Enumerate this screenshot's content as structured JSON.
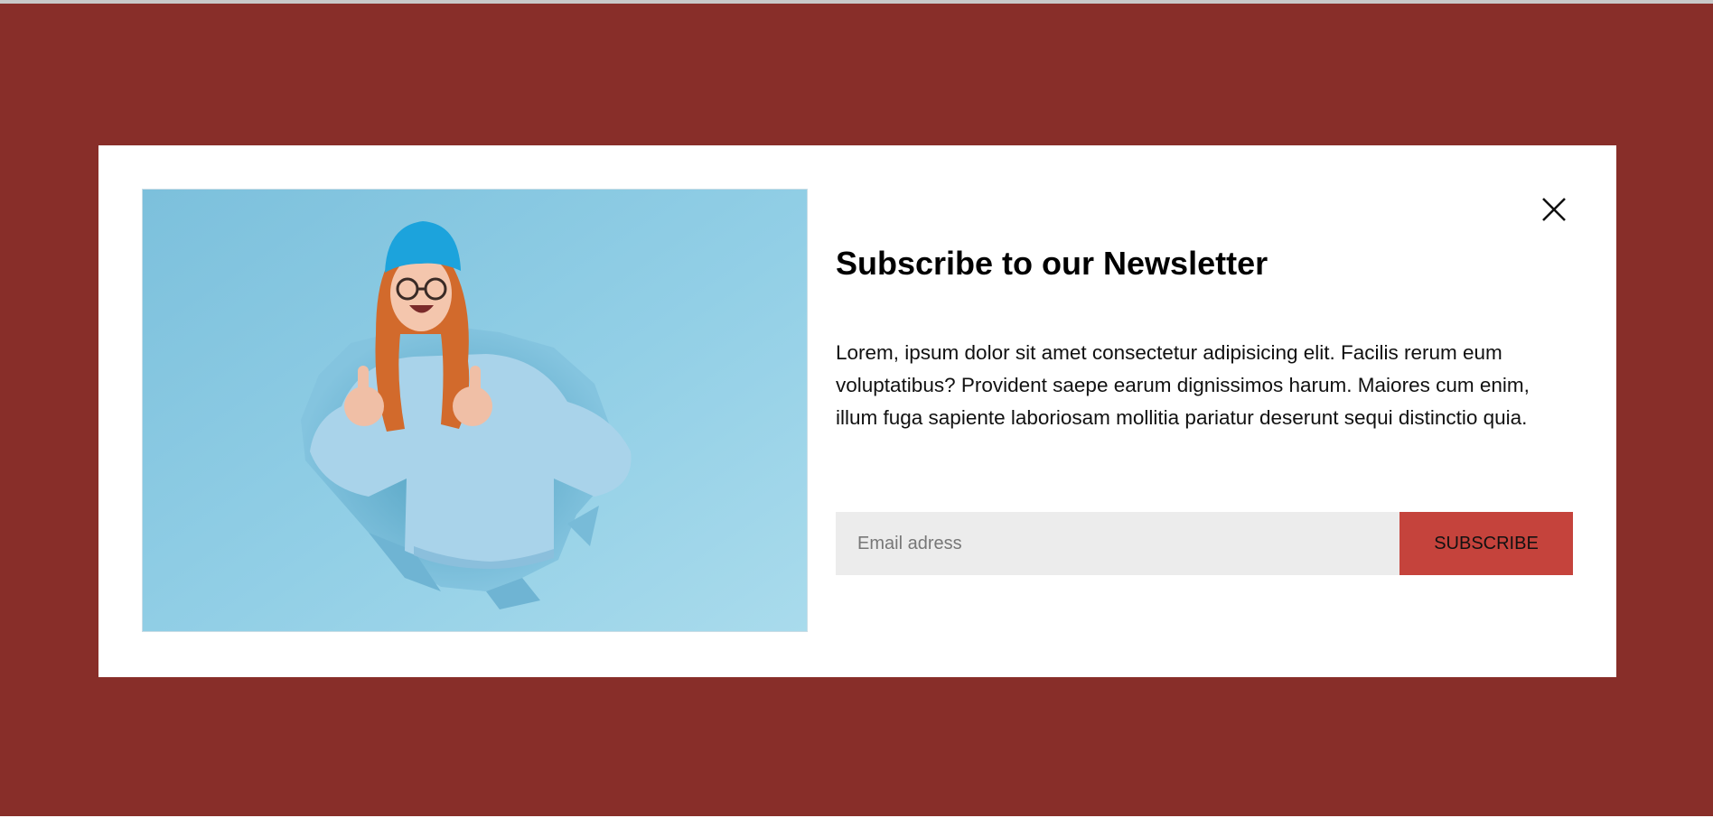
{
  "colors": {
    "backdrop": "#882e29",
    "modal_background": "#ffffff",
    "accent": "#c5433c",
    "input_background": "#ececec"
  },
  "newsletter": {
    "title": "Subscribe to our Newsletter",
    "description": "Lorem, ipsum dolor sit amet consectetur adipisicing elit. Facilis rerum eum voluptatibus? Provident saepe earum dignissimos harum. Maiores cum enim, illum fuga sapiente laboriosam mollitia pariatur deserunt sequi distinctio quia.",
    "email_placeholder": "Email adress",
    "email_value": "",
    "subscribe_label": "SUBSCRIBE",
    "close_icon": "close-icon",
    "hero_image": "woman-thumbs-up-through-paper-photo"
  }
}
